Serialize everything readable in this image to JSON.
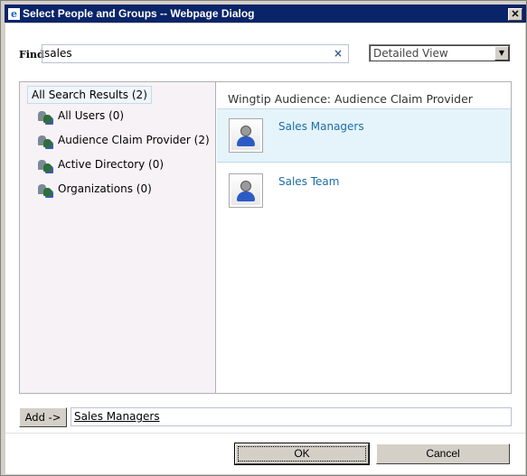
{
  "window": {
    "title": "Select People and Groups -- Webpage Dialog"
  },
  "find": {
    "label": "Find",
    "value": "sales",
    "clear": "×"
  },
  "view_select": {
    "value": "Detailed View"
  },
  "sidebar": {
    "all_results": "All Search Results (2)",
    "items": [
      {
        "label": "All Users (0)"
      },
      {
        "label": "Audience Claim Provider (2)"
      },
      {
        "label": "Active Directory (0)"
      },
      {
        "label": "Organizations (0)"
      }
    ]
  },
  "results": {
    "header": "Wingtip Audience: Audience Claim Provider",
    "items": [
      {
        "name": "Sales Managers",
        "selected": true
      },
      {
        "name": "Sales Team",
        "selected": false
      }
    ]
  },
  "add": {
    "label": "Add ->",
    "value": "Sales Managers"
  },
  "buttons": {
    "ok": "OK",
    "cancel": "Cancel"
  }
}
